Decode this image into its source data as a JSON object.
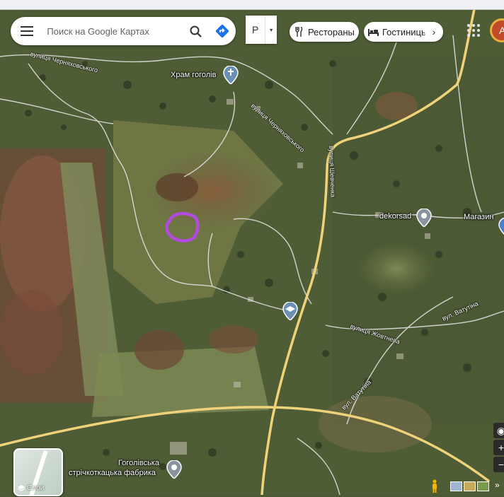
{
  "search": {
    "placeholder": "Поиск на Google Картах"
  },
  "input_tool": {
    "lang": "Р",
    "caret": "▾"
  },
  "chips": {
    "restaurants": "Рестораны",
    "hotels": "Гостиниць"
  },
  "avatar_letter": "А",
  "places": {
    "church": "Храм гоголів",
    "dekorsad": "dekorsad",
    "shop": "Магазин",
    "factory_line1": "Гоголівська",
    "factory_line2": "стрічкоткацька фабрика"
  },
  "streets": {
    "chernyakhovskoho_top": "вулиця Черняховського",
    "chernyakhovskoho_mid": "вулиця Черняховського",
    "shevchenka": "вулиця Шевченка",
    "vatutina_right": "вул. Ватутіна",
    "zhovtneva": "вулиця Жовтнева",
    "vatutina_bottom": "вул. Ватутіна"
  },
  "layers_label": "Слои",
  "zoom": {
    "in": "+",
    "out": "−"
  },
  "colors": {
    "road_yellow": "#f0d27a",
    "annotation_purple": "#b34be0",
    "pin_blue": "#6b8fb5"
  }
}
